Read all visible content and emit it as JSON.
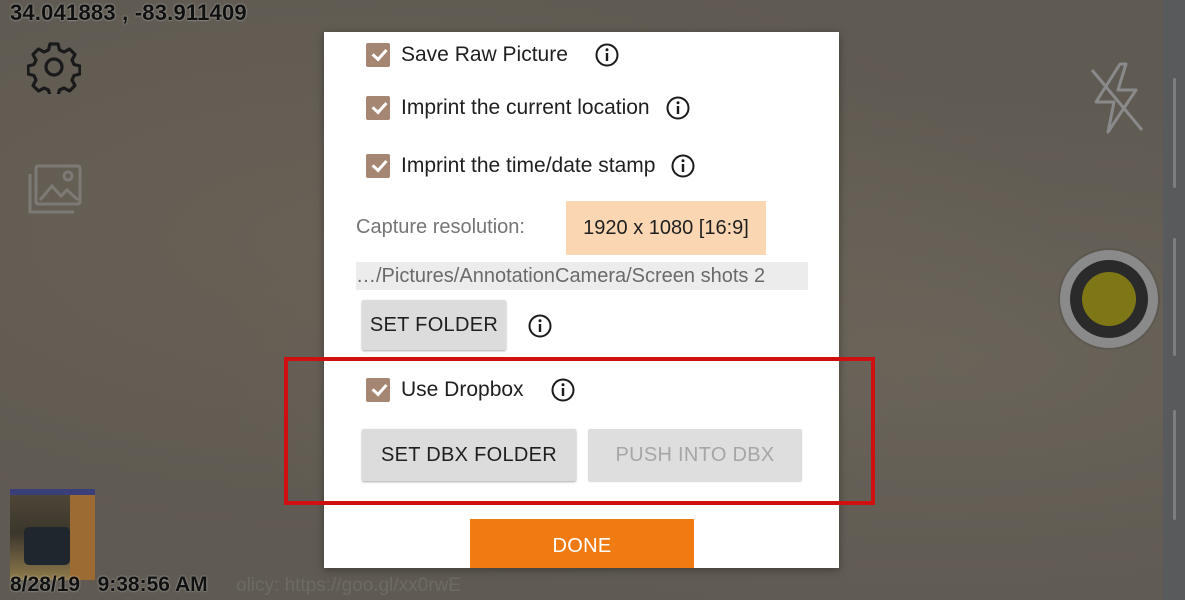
{
  "status": {
    "gps_coordinates": "34.041883 , -83.911409",
    "datetime": "8/28/19   9:38:56 AM",
    "policy_text": "olicy: https://goo.gl/xx0rwE"
  },
  "left_controls": {
    "settings_icon": "gear-icon",
    "gallery_icon": "gallery-icon"
  },
  "right_controls": {
    "flash_icon": "flash-off-icon",
    "shutter_icon": "shutter-button"
  },
  "dialog": {
    "options": [
      {
        "label": "Save Raw Picture",
        "checked": true
      },
      {
        "label": "Imprint the current location",
        "checked": true
      },
      {
        "label": "Imprint the time/date stamp",
        "checked": true
      }
    ],
    "capture_resolution_label": "Capture resolution:",
    "capture_resolution_value": "1920 x 1080 [16:9]",
    "folder_path": "…/Pictures/AnnotationCamera/Screen shots 2",
    "set_folder_label": "SET FOLDER",
    "dropbox": {
      "label": "Use Dropbox",
      "checked": true,
      "set_folder_label": "SET DBX FOLDER",
      "push_label": "PUSH INTO DBX"
    },
    "done_label": "DONE"
  },
  "colors": {
    "checkbox": "#a58672",
    "resolution_highlight": "#fbd6b3",
    "done_button": "#f07b13",
    "highlight_border": "#d01010",
    "shutter_core": "#7f7715"
  }
}
